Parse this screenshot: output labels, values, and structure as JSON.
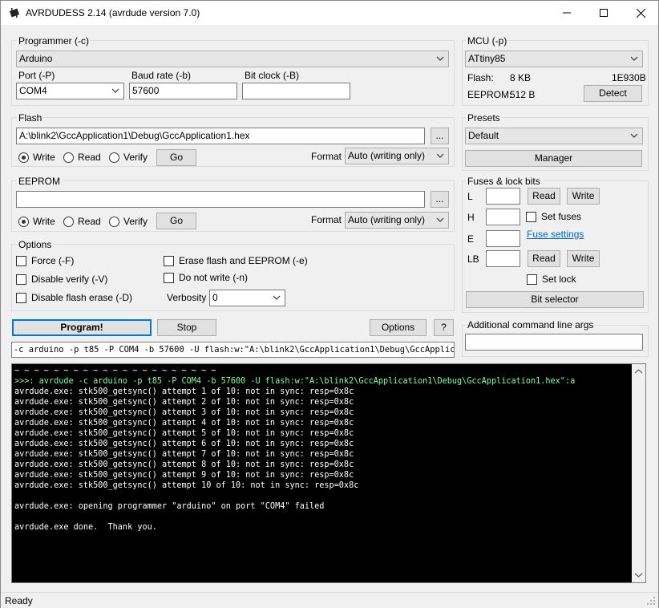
{
  "window": {
    "title": "AVRDUDESS 2.14 (avrdude version 7.0)"
  },
  "programmer": {
    "group_label": "Programmer (-c)",
    "selected": "Arduino",
    "port_label": "Port (-P)",
    "port_value": "COM4",
    "baud_label": "Baud rate (-b)",
    "baud_value": "57600",
    "bitclock_label": "Bit clock (-B)",
    "bitclock_value": ""
  },
  "mcu": {
    "group_label": "MCU (-p)",
    "selected": "ATtiny85",
    "flash_label": "Flash:",
    "flash_value": "8 KB",
    "signature": "1E930B",
    "eeprom_label": "EEPROM:",
    "eeprom_value": "512 B",
    "detect_label": "Detect"
  },
  "flash": {
    "group_label": "Flash",
    "file_path": "A:\\blink2\\GccApplication1\\Debug\\GccApplication1.hex",
    "browse_label": "...",
    "radio_write": "Write",
    "radio_read": "Read",
    "radio_verify": "Verify",
    "go_label": "Go",
    "format_label": "Format",
    "format_value": "Auto (writing only)"
  },
  "eeprom": {
    "group_label": "EEPROM",
    "file_path": "",
    "browse_label": "...",
    "radio_write": "Write",
    "radio_read": "Read",
    "radio_verify": "Verify",
    "go_label": "Go",
    "format_label": "Format",
    "format_value": "Auto (writing only)"
  },
  "presets": {
    "group_label": "Presets",
    "selected": "Default",
    "manager_label": "Manager"
  },
  "fuses": {
    "group_label": "Fuses & lock bits",
    "l_label": "L",
    "h_label": "H",
    "e_label": "E",
    "lb_label": "LB",
    "read_label": "Read",
    "write_label": "Write",
    "set_fuses_label": "Set fuses",
    "fuse_settings_label": "Fuse settings",
    "set_lock_label": "Set lock",
    "bit_selector_label": "Bit selector"
  },
  "options": {
    "group_label": "Options",
    "force": "Force (-F)",
    "disable_verify": "Disable verify (-V)",
    "disable_flash_erase": "Disable flash erase (-D)",
    "erase_flash_eeprom": "Erase flash and EEPROM (-e)",
    "do_not_write": "Do not write (-n)",
    "verbosity_label": "Verbosity",
    "verbosity_value": "0"
  },
  "actions": {
    "program_label": "Program!",
    "stop_label": "Stop",
    "options_label": "Options",
    "help_label": "?"
  },
  "additional_args": {
    "group_label": "Additional command line args",
    "value": ""
  },
  "command_line": "-c arduino -p t85 -P COM4 -b 57600 -U flash:w:\"A:\\blink2\\GccApplication1\\Debug\\GccApplicati",
  "console": {
    "separator": "~ ~ ~ ~ ~ ~ ~ ~ ~ ~ ~ ~ ~ ~ ~ ~ ~ ~ ~ ~ ~",
    "command": ">>>: avrdude -c arduino -p t85 -P COM4 -b 57600 -U flash:w:\"A:\\blink2\\GccApplication1\\Debug\\GccApplication1.hex\":a",
    "lines": [
      "avrdude.exe: stk500_getsync() attempt 1 of 10: not in sync: resp=0x8c",
      "avrdude.exe: stk500_getsync() attempt 2 of 10: not in sync: resp=0x8c",
      "avrdude.exe: stk500_getsync() attempt 3 of 10: not in sync: resp=0x8c",
      "avrdude.exe: stk500_getsync() attempt 4 of 10: not in sync: resp=0x8c",
      "avrdude.exe: stk500_getsync() attempt 5 of 10: not in sync: resp=0x8c",
      "avrdude.exe: stk500_getsync() attempt 6 of 10: not in sync: resp=0x8c",
      "avrdude.exe: stk500_getsync() attempt 7 of 10: not in sync: resp=0x8c",
      "avrdude.exe: stk500_getsync() attempt 8 of 10: not in sync: resp=0x8c",
      "avrdude.exe: stk500_getsync() attempt 9 of 10: not in sync: resp=0x8c",
      "avrdude.exe: stk500_getsync() attempt 10 of 10: not in sync: resp=0x8c",
      "",
      "avrdude.exe: opening programmer \"arduino\" on port \"COM4\" failed",
      "",
      "avrdude.exe done.  Thank you."
    ]
  },
  "status": {
    "text": "Ready"
  },
  "colors": {
    "accent": "#0078d7",
    "console_bg": "#000000",
    "console_cmd": "#7fffa0"
  }
}
